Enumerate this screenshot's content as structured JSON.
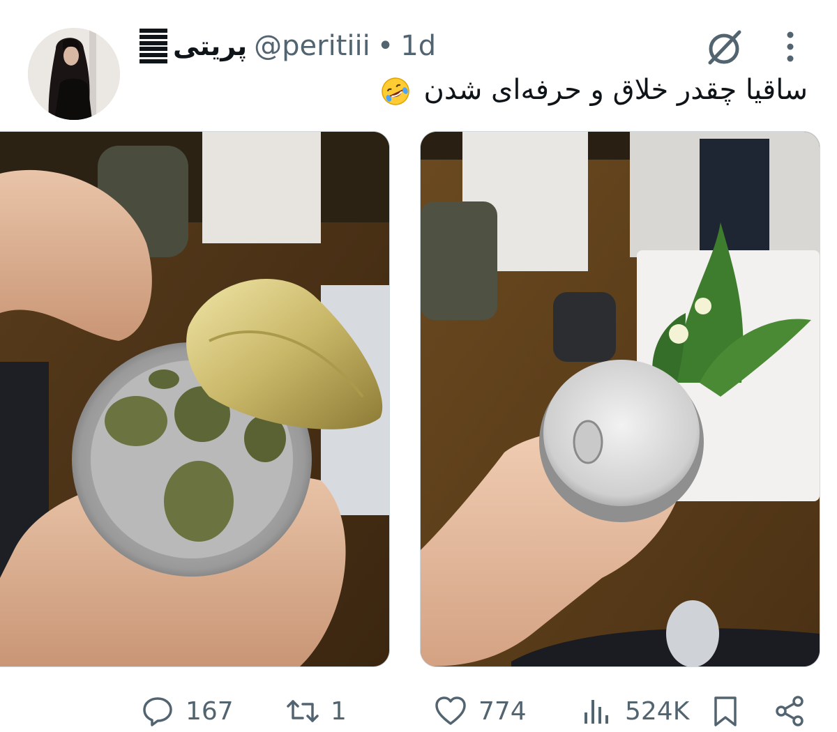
{
  "post": {
    "display_name": "پریتی",
    "handle": "@peritiii",
    "separator": "•",
    "time": "1d",
    "text": "ساقیا چقدر خلاق و حرفه‌ای شدن",
    "emoji": "rolling-on-floor-laughing-emoji"
  },
  "actions": {
    "replies": "167",
    "reposts": "1",
    "likes": "774",
    "views": "524K"
  },
  "media": [
    {
      "description_icon": "photo"
    },
    {
      "description_icon": "photo"
    }
  ],
  "colors": {
    "text": "#0f1419",
    "secondary": "#536471",
    "border": "#cfd9de"
  }
}
